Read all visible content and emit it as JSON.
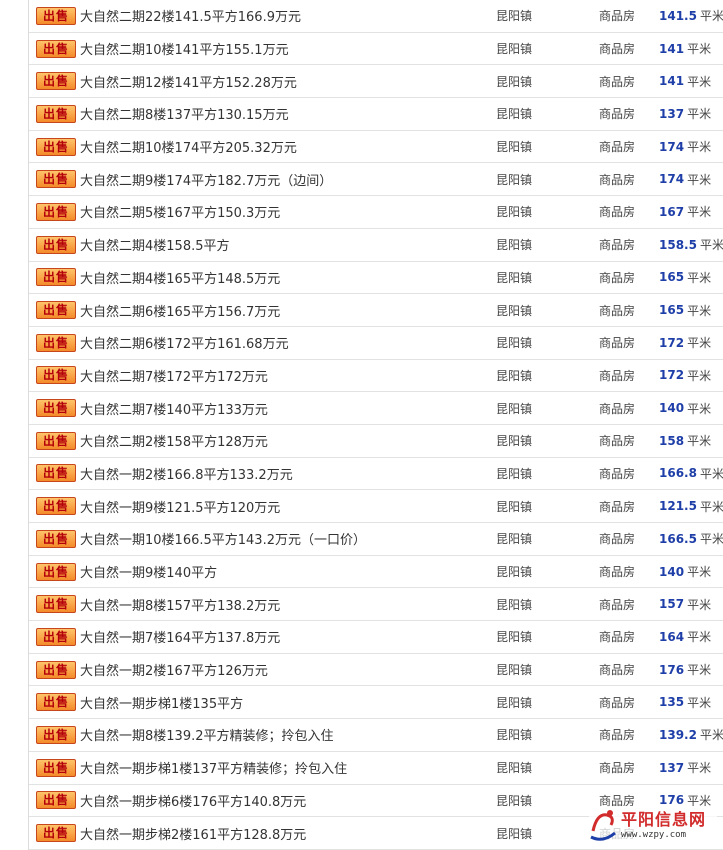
{
  "badge_label": "出售",
  "unit": "平米",
  "watermark": {
    "name": "平阳信息网",
    "url": "www.wzpy.com"
  },
  "listings": [
    {
      "title": "大自然二期22楼141.5平方166.9万元",
      "town": "昆阳镇",
      "type": "商品房",
      "area": "141.5"
    },
    {
      "title": "大自然二期10楼141平方155.1万元",
      "town": "昆阳镇",
      "type": "商品房",
      "area": "141"
    },
    {
      "title": "大自然二期12楼141平方152.28万元",
      "town": "昆阳镇",
      "type": "商品房",
      "area": "141"
    },
    {
      "title": "大自然二期8楼137平方130.15万元",
      "town": "昆阳镇",
      "type": "商品房",
      "area": "137"
    },
    {
      "title": "大自然二期10楼174平方205.32万元",
      "town": "昆阳镇",
      "type": "商品房",
      "area": "174"
    },
    {
      "title": "大自然二期9楼174平方182.7万元（边间）",
      "town": "昆阳镇",
      "type": "商品房",
      "area": "174"
    },
    {
      "title": "大自然二期5楼167平方150.3万元",
      "town": "昆阳镇",
      "type": "商品房",
      "area": "167"
    },
    {
      "title": "大自然二期4楼158.5平方",
      "town": "昆阳镇",
      "type": "商品房",
      "area": "158.5"
    },
    {
      "title": "大自然二期4楼165平方148.5万元",
      "town": "昆阳镇",
      "type": "商品房",
      "area": "165"
    },
    {
      "title": "大自然二期6楼165平方156.7万元",
      "town": "昆阳镇",
      "type": "商品房",
      "area": "165"
    },
    {
      "title": "大自然二期6楼172平方161.68万元",
      "town": "昆阳镇",
      "type": "商品房",
      "area": "172"
    },
    {
      "title": "大自然二期7楼172平方172万元",
      "town": "昆阳镇",
      "type": "商品房",
      "area": "172"
    },
    {
      "title": "大自然二期7楼140平方133万元",
      "town": "昆阳镇",
      "type": "商品房",
      "area": "140"
    },
    {
      "title": "大自然二期2楼158平方128万元",
      "town": "昆阳镇",
      "type": "商品房",
      "area": "158"
    },
    {
      "title": "大自然一期2楼166.8平方133.2万元",
      "town": "昆阳镇",
      "type": "商品房",
      "area": "166.8"
    },
    {
      "title": "大自然一期9楼121.5平方120万元",
      "town": "昆阳镇",
      "type": "商品房",
      "area": "121.5"
    },
    {
      "title": "大自然一期10楼166.5平方143.2万元（一口价）",
      "town": "昆阳镇",
      "type": "商品房",
      "area": "166.5"
    },
    {
      "title": "大自然一期9楼140平方",
      "town": "昆阳镇",
      "type": "商品房",
      "area": "140"
    },
    {
      "title": "大自然一期8楼157平方138.2万元",
      "town": "昆阳镇",
      "type": "商品房",
      "area": "157"
    },
    {
      "title": "大自然一期7楼164平方137.8万元",
      "town": "昆阳镇",
      "type": "商品房",
      "area": "164"
    },
    {
      "title": "大自然一期2楼167平方126万元",
      "town": "昆阳镇",
      "type": "商品房",
      "area": "176"
    },
    {
      "title": "大自然一期步梯1楼135平方",
      "town": "昆阳镇",
      "type": "商品房",
      "area": "135"
    },
    {
      "title": "大自然一期8楼139.2平方精装修；拎包入住",
      "town": "昆阳镇",
      "type": "商品房",
      "area": "139.2"
    },
    {
      "title": "大自然一期步梯1楼137平方精装修；拎包入住",
      "town": "昆阳镇",
      "type": "商品房",
      "area": "137"
    },
    {
      "title": "大自然一期步梯6楼176平方140.8万元",
      "town": "昆阳镇",
      "type": "商品房",
      "area": "176"
    },
    {
      "title": "大自然一期步梯2楼161平方128.8万元",
      "town": "昆阳镇",
      "type": "商品房",
      "area": ""
    }
  ]
}
